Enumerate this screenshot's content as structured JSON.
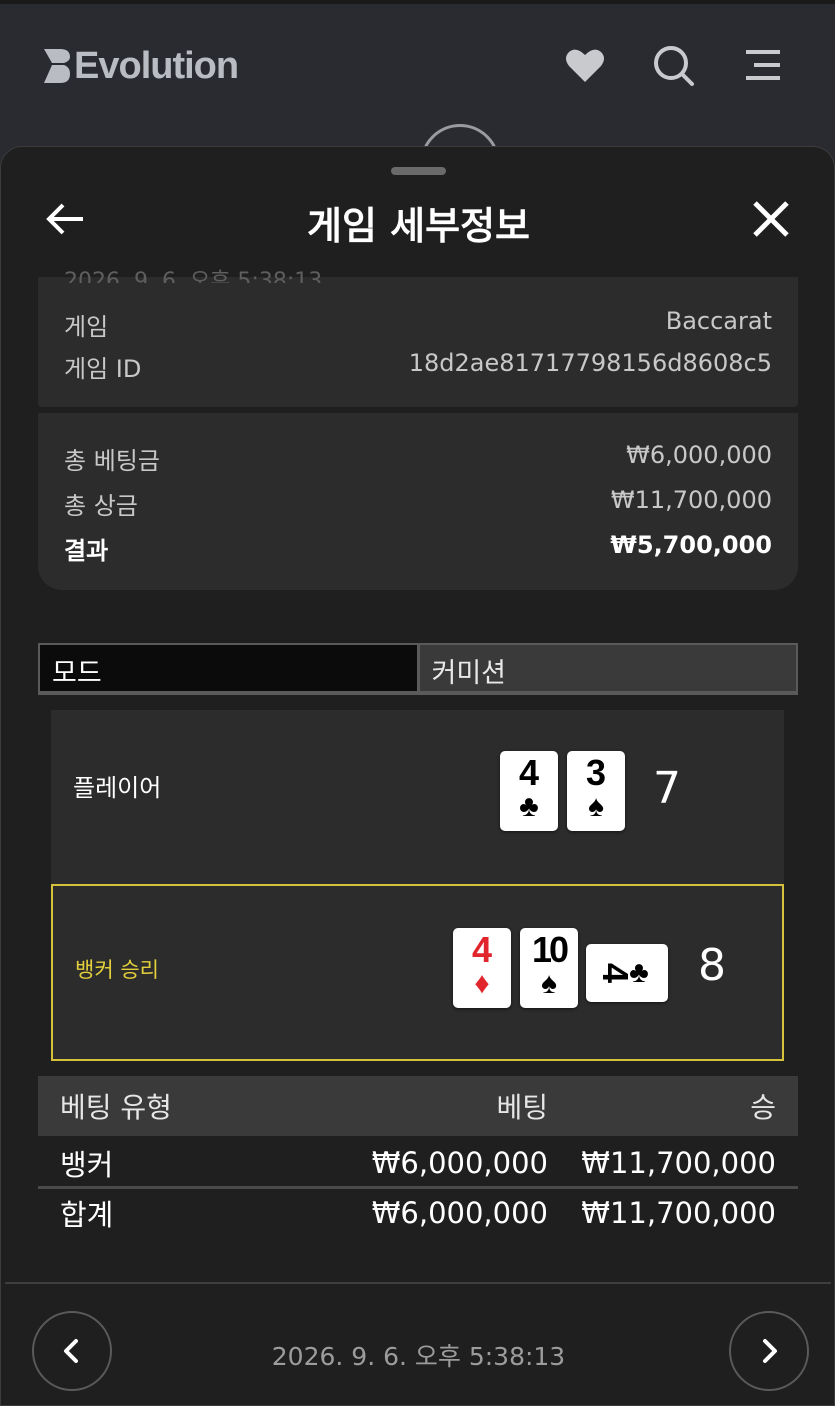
{
  "app": {
    "logo_text": "Evolution"
  },
  "header": {
    "title": "게임 세부정보"
  },
  "summary": {
    "faded_line": "2026. 9. 6. 오후 5:38:13",
    "game_label": "게임",
    "game_value": "Baccarat",
    "game_id_label": "게임 ID",
    "game_id_value": "18d2ae81717798156d8608c5",
    "total_bet_label": "총 베팅금",
    "total_bet_value": "₩6,000,000",
    "total_prize_label": "총 상금",
    "total_prize_value": "₩11,700,000",
    "result_label": "결과",
    "result_value": "₩5,700,000"
  },
  "tabs": [
    {
      "label": "모드"
    },
    {
      "label": "커미션"
    }
  ],
  "player": {
    "label": "플레이어",
    "cards": [
      {
        "rank": "4",
        "suit": "♣"
      },
      {
        "rank": "3",
        "suit": "♠"
      }
    ],
    "score": "7"
  },
  "banker": {
    "label": "뱅커 승리",
    "cards": [
      {
        "rank": "4",
        "suit": "♦"
      },
      {
        "rank": "10",
        "suit": "♠"
      },
      {
        "rank": "4",
        "suit": "♣"
      }
    ],
    "score": "8"
  },
  "bets": {
    "headers": [
      "베팅 유형",
      "베팅",
      "승"
    ],
    "rows": [
      [
        "뱅커",
        "₩6,000,000",
        "₩11,700,000"
      ],
      [
        "합계",
        "₩6,000,000",
        "₩11,700,000"
      ]
    ]
  },
  "footer": {
    "date": "2026. 9. 6. 오후 5:38:13"
  },
  "colors": {
    "winner_border": "#d6c23a",
    "winner_label": "#e3cf3c",
    "red_suit": "#e0262c"
  }
}
